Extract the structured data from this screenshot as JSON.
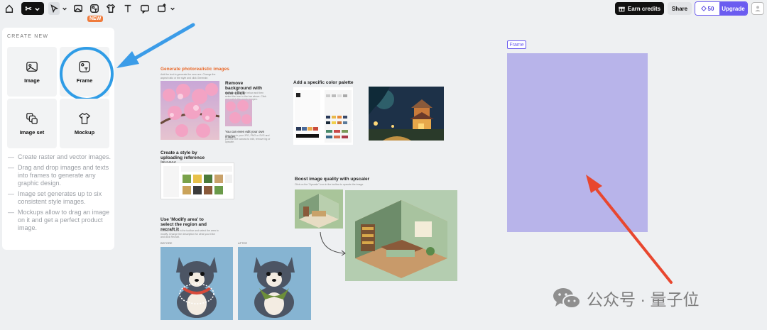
{
  "toolbar": {
    "new_badge": "NEW",
    "earn_credits": "Earn credits",
    "share": "Share",
    "credits_count": "50",
    "upgrade": "Upgrade",
    "icons": [
      "home-icon",
      "logo-icon",
      "chevron-down-icon",
      "select-cursor-icon",
      "chevron-down-icon",
      "image-tool-icon",
      "frame-tool-icon",
      "mockup-tool-icon",
      "text-tool-icon",
      "comment-icon",
      "upload-icon",
      "chevron-down-icon",
      "gift-icon",
      "diamond-icon",
      "user-icon"
    ]
  },
  "panel": {
    "title": "CREATE NEW",
    "cards": [
      {
        "label": "Image",
        "icon": "image-icon"
      },
      {
        "label": "Frame",
        "icon": "frame-icon"
      },
      {
        "label": "Image set",
        "icon": "image-set-icon"
      },
      {
        "label": "Mockup",
        "icon": "tshirt-icon"
      }
    ],
    "tips": [
      "Create raster and vector images.",
      "Drag and drop images and texts into frames to generate any graphic design.",
      "Image set generates up to six consistent style images.",
      "Mockups allow to drag an image on it and get a perfect product image."
    ]
  },
  "canvas": {
    "photo_heading": "Generate photorealistic images",
    "photo_sub": "Add the text to generate the new one. Change the aspect ratio or the style and click Generate.",
    "remove_bg_heading": "Remove background with one click",
    "remove_bg_sub": "Uncover the image below and then select the icon in the bar above. Click and watch the magic happen.",
    "edit_own": "You can even edit your own images",
    "edit_own_sub": "Just drop in your JPG, PNG or SVG and put it on the canvas to edit, remove bg or upscale.",
    "palette_heading": "Add a specific color palette",
    "style_heading": "Create a style by uploading reference images",
    "style_sub": "Upload style options and prices for the use case in 4-6 images.",
    "upscale_heading": "Boost image quality with upscaler",
    "upscale_sub": "Click on the \"Upscale\" icon in the toolbar to upscale the image.",
    "modify_heading": "Use 'Modify area' to select the region and recraft it",
    "modify_sub": "Choose the area in the toolbar and select the area to modify. Change the description for what you'd like and click Recraft.",
    "before_label": "BEFORE",
    "after_label": "AFTER",
    "frame_label": "Frame"
  },
  "watermark": {
    "text": "公众号 · 量子位"
  },
  "colors": {
    "accent": "#6b5cf0",
    "frame_fill": "#b8b4ea",
    "blue_arrow": "#3b9ce8",
    "red_arrow": "#e8472f",
    "orange_heading": "#e96a2c",
    "new_badge": "#ef7b3c"
  }
}
